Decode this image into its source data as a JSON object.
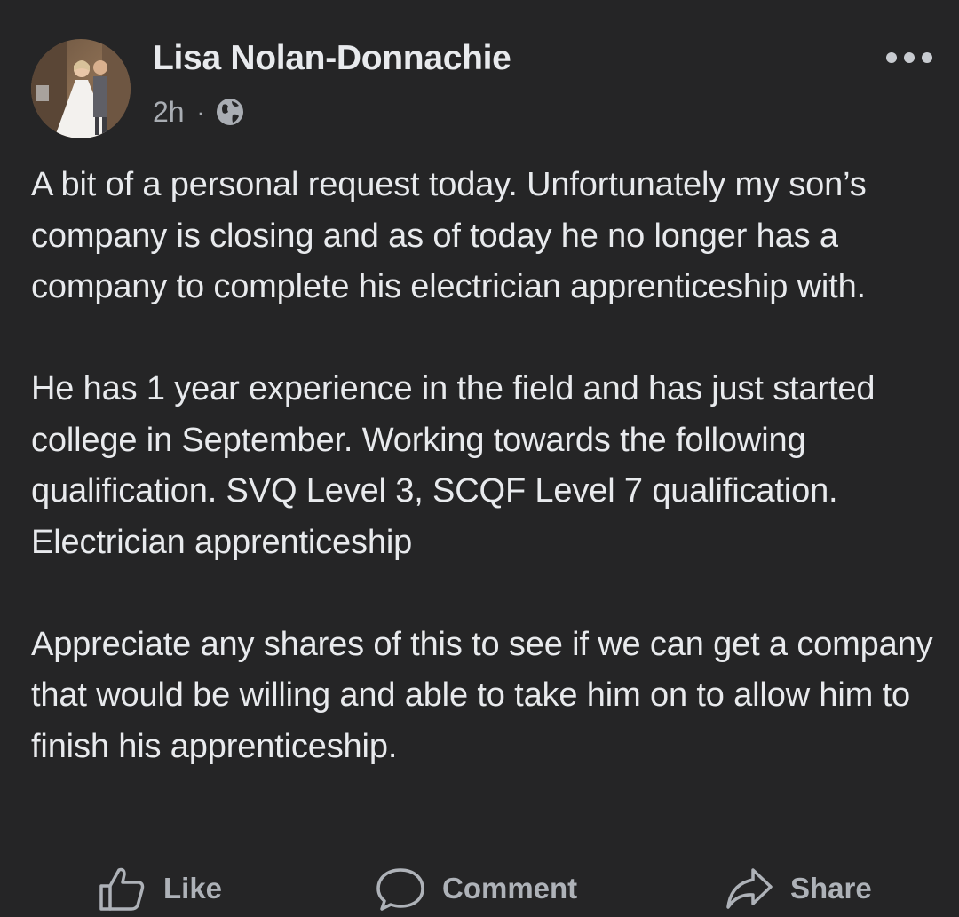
{
  "post": {
    "author": {
      "name": "Lisa Nolan-Donnachie",
      "avatar_icon": "profile-photo-wedding"
    },
    "meta": {
      "time": "2h",
      "separator": "·",
      "audience_icon": "globe-icon"
    },
    "more_icon": "ellipsis-icon",
    "body": {
      "paragraphs": [
        "A bit of a personal request today. Unfortunately my son’s company is closing and as of today he no longer has a company to complete his electrician apprenticeship with.",
        "He has 1 year experience in the field and has just started college in September. Working towards the following qualification. SVQ Level 3, SCQF Level 7 qualification. Electrician apprenticeship",
        "Appreciate any shares of this to see if we can get a company that would be willing and able to take him on to allow him to finish his apprenticeship."
      ]
    },
    "actions": {
      "like_label": "Like",
      "like_icon": "thumbs-up-icon",
      "comment_label": "Comment",
      "comment_icon": "speech-bubble-icon",
      "share_label": "Share",
      "share_icon": "share-arrow-icon"
    }
  },
  "colors": {
    "background": "#252526",
    "text_primary": "#e8eaed",
    "text_secondary": "#a9adb3",
    "action_text": "#aeb2b8"
  }
}
